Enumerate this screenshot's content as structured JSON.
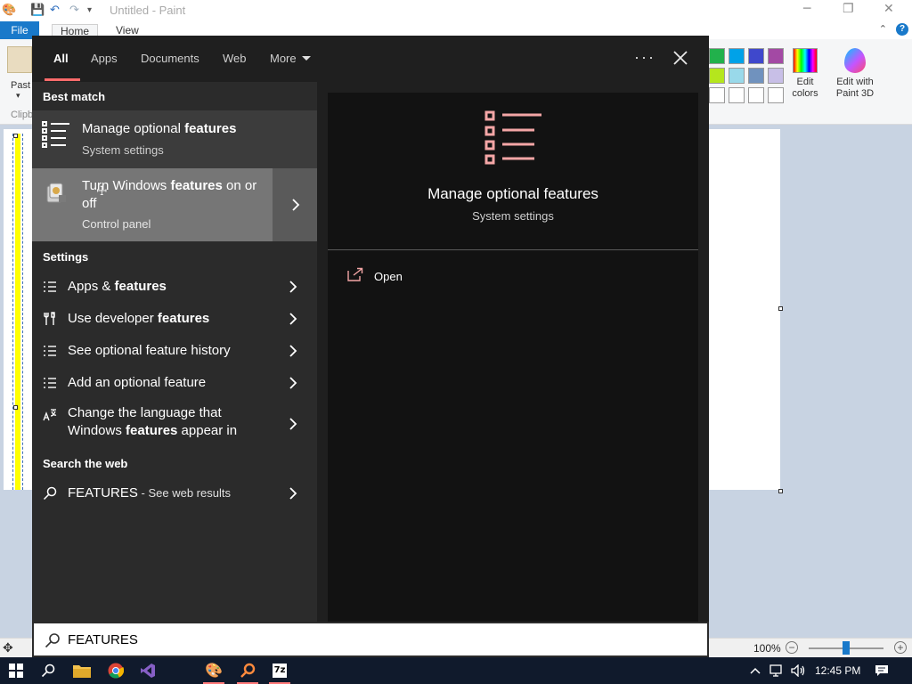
{
  "paint": {
    "window_title": "Untitled - Paint",
    "tabs": {
      "file": "File",
      "home": "Home",
      "view": "View"
    },
    "ribbon": {
      "paste_partial": "Past",
      "clipboard_partial": "Clipb",
      "edit_colors": "Edit colors",
      "edit_paint3d": "Edit with Paint 3D"
    },
    "status": {
      "zoom": "100%"
    },
    "colors": {
      "accent": "#1979ca",
      "workspace": "#c8d3e2"
    }
  },
  "search": {
    "tabs": [
      {
        "label": "All",
        "active": true
      },
      {
        "label": "Apps"
      },
      {
        "label": "Documents"
      },
      {
        "label": "Web"
      },
      {
        "label": "More"
      }
    ],
    "sections": {
      "best_match": "Best match",
      "settings": "Settings",
      "web": "Search the web"
    },
    "best_match": {
      "title_pre": "Manage optional ",
      "title_bold": "features",
      "subtitle": "System settings"
    },
    "hover_item": {
      "title_pre": "Turn Windows ",
      "title_bold": "features",
      "title_post": " on or off",
      "subtitle": "Control panel"
    },
    "settings_items": [
      {
        "pre": "Apps & ",
        "bold": "features",
        "post": ""
      },
      {
        "pre": "Use developer ",
        "bold": "features",
        "post": ""
      },
      {
        "pre": "See optional feature history",
        "bold": "",
        "post": ""
      },
      {
        "pre": "Add an optional feature",
        "bold": "",
        "post": ""
      },
      {
        "pre": "Change the language that",
        "line2_pre": "Windows ",
        "bold": "features",
        "post": " appear in"
      }
    ],
    "web_result": {
      "query": "FEATURES",
      "suffix": " - See web results"
    },
    "preview": {
      "title": "Manage optional features",
      "subtitle": "System settings",
      "action": "Open"
    },
    "query_value": "FEATURES",
    "colors": {
      "accent": "#ff6b6b",
      "icon_pink": "#f4a6a6"
    }
  },
  "taskbar": {
    "time": "12:45 PM",
    "apps": [
      "start-icon",
      "search-icon",
      "file-explorer-icon",
      "chrome-icon",
      "visual-studio-icon",
      "paint-icon",
      "search-app-icon",
      "seven-zip-icon"
    ]
  }
}
